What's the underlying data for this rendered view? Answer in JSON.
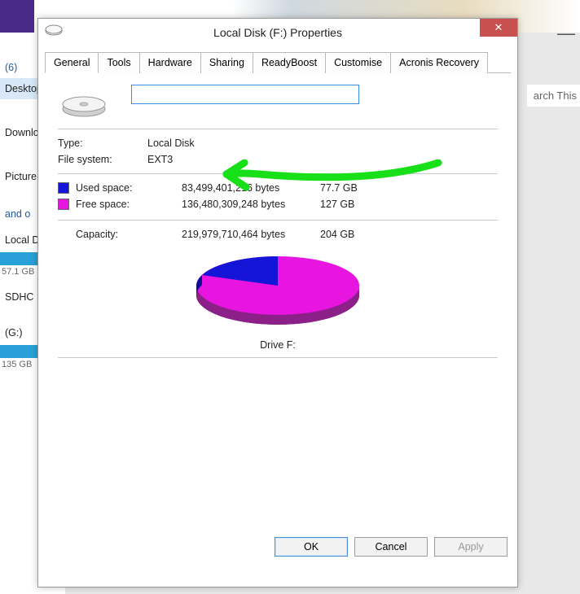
{
  "window": {
    "title": "Local Disk (F:) Properties",
    "close": "✕"
  },
  "tabs": {
    "general": "General",
    "tools": "Tools",
    "hardware": "Hardware",
    "sharing": "Sharing",
    "readyboost": "ReadyBoost",
    "customise": "Customise",
    "acronis": "Acronis Recovery"
  },
  "general": {
    "name_value": "",
    "type_label": "Type:",
    "type_value": "Local Disk",
    "fs_label": "File system:",
    "fs_value": "EXT3",
    "used_label": "Used space:",
    "used_bytes": "83,499,401,216 bytes",
    "used_gb": "77.7 GB",
    "free_label": "Free space:",
    "free_bytes": "136,480,309,248 bytes",
    "free_gb": "127 GB",
    "capacity_label": "Capacity:",
    "capacity_bytes": "219,979,710,464 bytes",
    "capacity_gb": "204 GB",
    "drive_label": "Drive F:"
  },
  "buttons": {
    "ok": "OK",
    "cancel": "Cancel",
    "apply": "Apply"
  },
  "colors": {
    "used": "#1515d8",
    "free": "#e815e0"
  },
  "chart_data": {
    "type": "pie",
    "title": "Drive F:",
    "series": [
      {
        "name": "Used space",
        "value": 83499401216,
        "color": "#1515d8"
      },
      {
        "name": "Free space",
        "value": 136480309248,
        "color": "#e815e0"
      }
    ]
  },
  "background": {
    "count6": "(6)",
    "desktop": "Desktop",
    "downloads": "Downlo",
    "pictures": "Picture",
    "and_o": "and o",
    "local_d": "Local D",
    "local_size": "57.1 GB",
    "sdhc": "SDHC",
    "g": "(G:)",
    "g_size": "135 GB",
    "search": "arch This"
  }
}
